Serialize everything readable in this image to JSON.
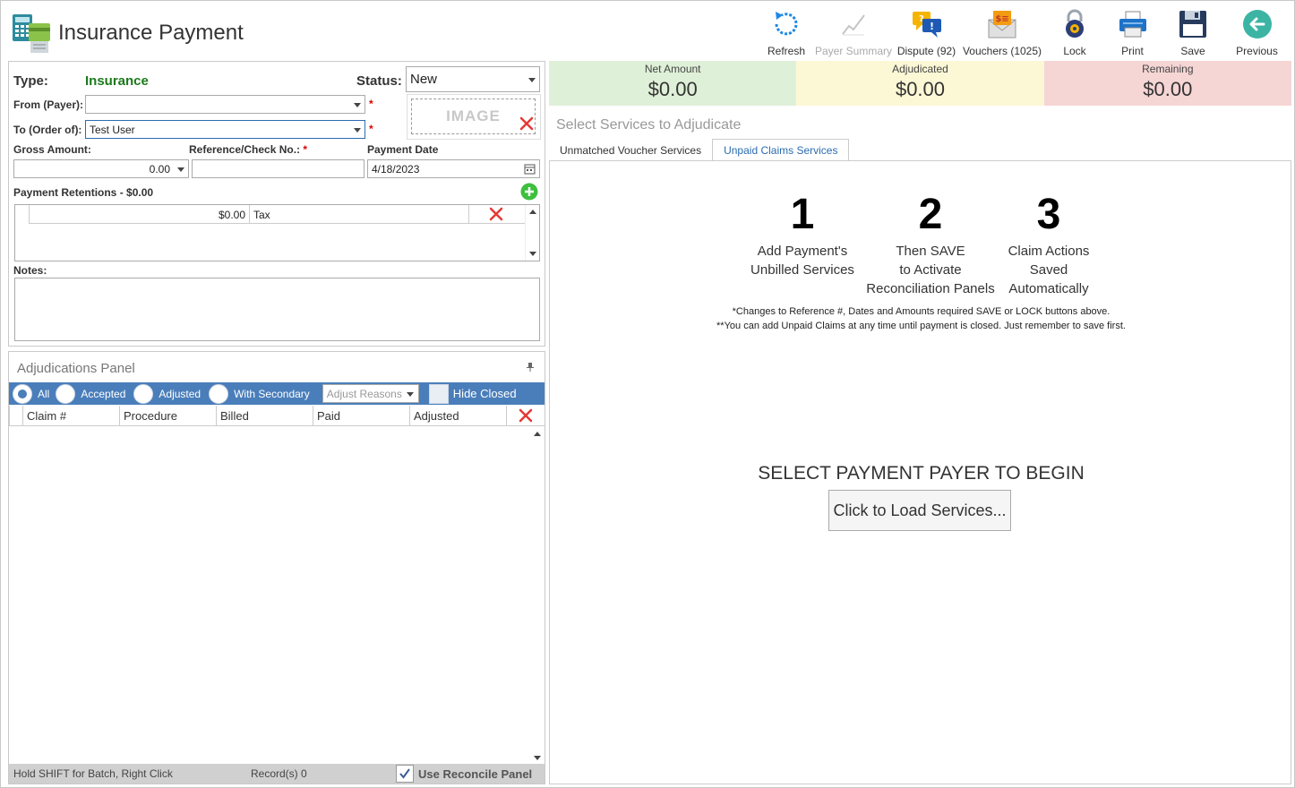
{
  "app": {
    "title": "Insurance Payment"
  },
  "toolbar": {
    "refresh": "Refresh",
    "payer_summary": "Payer Summary",
    "dispute": "Dispute (92)",
    "vouchers": "Vouchers (1025)",
    "lock": "Lock",
    "print": "Print",
    "save": "Save",
    "previous": "Previous"
  },
  "form": {
    "type_label": "Type:",
    "type_value": "Insurance",
    "status_label": "Status:",
    "status_value": "New",
    "from_label": "From (Payer):",
    "from_value": "",
    "to_label": "To (Order of):",
    "to_value": "Test User",
    "required_mark": "*",
    "image_label": "IMAGE",
    "gross_label": "Gross Amount:",
    "gross_value": "0.00",
    "reference_label": "Reference/Check No.:",
    "reference_value": "",
    "payment_date_label": "Payment Date",
    "payment_date_value": "4/18/2023",
    "retentions_label": "Payment Retentions - $0.00",
    "retention_rows": [
      {
        "amount": "$0.00",
        "type": "Tax"
      }
    ],
    "notes_label": "Notes:",
    "notes_value": ""
  },
  "adjudications": {
    "title": "Adjudications Panel",
    "filters": {
      "all": "All",
      "accepted": "Accepted",
      "adjusted": "Adjusted",
      "with_secondary": "With Secondary"
    },
    "adjust_reasons_placeholder": "Adjust Reasons",
    "hide_closed": "Hide Closed",
    "columns": {
      "claim": "Claim #",
      "procedure": "Procedure",
      "billed": "Billed",
      "paid": "Paid",
      "adjusted": "Adjusted"
    },
    "status_hint": "Hold SHIFT for Batch, Right Click",
    "records": "Record(s) 0",
    "use_reconcile": "Use Reconcile Panel"
  },
  "summary": {
    "net_label": "Net Amount",
    "net_value": "$0.00",
    "adjudicated_label": "Adjudicated",
    "adjudicated_value": "$0.00",
    "remaining_label": "Remaining",
    "remaining_value": "$0.00"
  },
  "services": {
    "title": "Select Services to Adjudicate",
    "tabs": {
      "unmatched": "Unmatched Voucher Services",
      "unpaid": "Unpaid Claims Services"
    },
    "steps": [
      {
        "num": "1",
        "line1": "Add Payment's",
        "line2": "Unbilled Services",
        "line3": ""
      },
      {
        "num": "2",
        "line1": "Then SAVE",
        "line2": "to Activate",
        "line3": "Reconciliation Panels"
      },
      {
        "num": "3",
        "line1": "Claim Actions",
        "line2": "Saved",
        "line3": "Automatically"
      }
    ],
    "note1": "*Changes to Reference #, Dates and Amounts required SAVE or LOCK buttons above.",
    "note2": "**You can add Unpaid Claims at any time until payment is closed. Just remember to save first.",
    "begin_text": "SELECT PAYMENT PAYER TO BEGIN",
    "load_button": "Click to Load Services..."
  },
  "colors": {
    "net_bg": "#dff0d8",
    "adjudicated_bg": "#fcf8d6",
    "remaining_bg": "#f6d5d5",
    "filter_bar": "#4a7eba",
    "type_green": "#1b7a1b"
  }
}
